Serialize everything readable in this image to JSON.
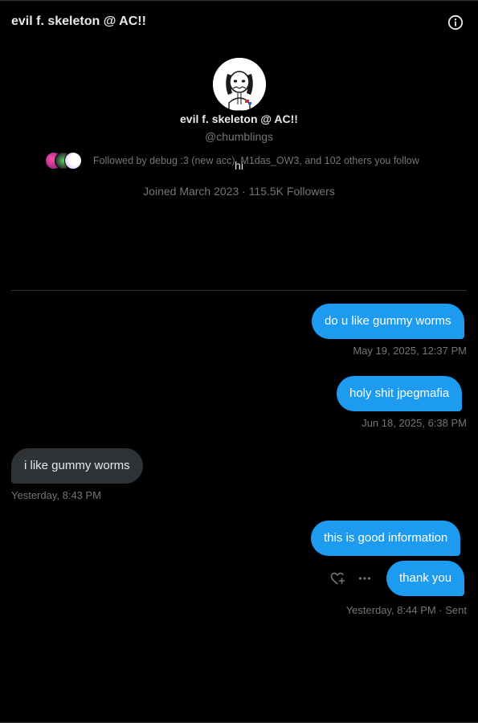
{
  "header": {
    "title": "evil f. skeleton @ AC!!",
    "info_icon": "info-icon"
  },
  "profile": {
    "display_name": "evil f. skeleton @ AC!!",
    "handle": "@chumblings",
    "bio": "hi",
    "meta": "Joined March 2023 · 115.5K Followers",
    "followed_by": "Followed by debug :3 (new acc), M1das_OW3, and 102 others you follow"
  },
  "messages": [
    {
      "direction": "sent",
      "text": "do u like gummy worms",
      "timestamp": "May 19, 2025, 12:37 PM"
    },
    {
      "direction": "sent",
      "text": "holy shit jpegmafia",
      "timestamp": "Jun 18, 2025, 6:38 PM"
    },
    {
      "direction": "received",
      "text": "i like gummy worms",
      "timestamp": "Yesterday, 8:43 PM"
    },
    {
      "direction": "sent",
      "text": "this is good information",
      "timestamp": ""
    },
    {
      "direction": "sent",
      "text": "thank you",
      "timestamp": "Yesterday, 8:44 PM · Sent"
    }
  ],
  "message_actions": {
    "react_icon": "heart-plus-icon",
    "more_icon": "more-horizontal-icon"
  },
  "colors": {
    "background": "#000000",
    "sent_bubble": "#1d9bf0",
    "received_bubble": "#2f3336",
    "muted_text": "#71767b"
  }
}
